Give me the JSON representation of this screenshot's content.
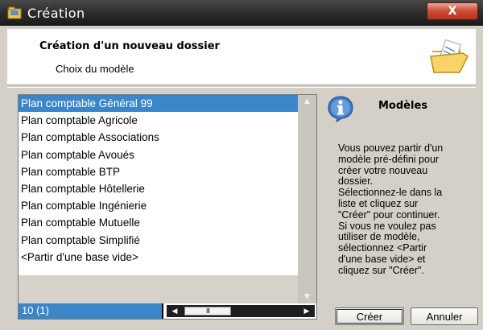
{
  "window": {
    "title": "Création",
    "close_label": "X"
  },
  "header": {
    "title": "Création d'un nouveau dossier",
    "subtitle": "Choix du modèle"
  },
  "list": {
    "items": [
      "Plan comptable  Général 99",
      "Plan comptable Agricole",
      "Plan comptable Associations",
      "Plan comptable Avoués",
      "Plan comptable BTP",
      "Plan comptable Hôtellerie",
      "Plan comptable Ingénierie",
      "Plan comptable Mutuelle",
      "Plan comptable Simplifié",
      "<Partir d'une base vide>"
    ],
    "selected_index": 0,
    "status_count": "10 (1)",
    "hscroll_thumb": "III"
  },
  "info": {
    "title": "Modèles",
    "text": "Vous pouvez partir d'un\nmodèle pré-défini pour\ncréer votre nouveau\ndossier.\nSélectionnez-le dans la\nliste et cliquez sur\n\"Créer\" pour continuer.\nSi vous ne voulez pas\nutiliser de modèle,\nsélectionnez <Partir\nd'une base vide> et\ncliquez sur \"Créer\"."
  },
  "buttons": {
    "create": "Créer",
    "cancel": "Annuler"
  },
  "colors": {
    "selection": "#3a86c8",
    "titlebar": "#2e2e2e",
    "close": "#c84a34"
  }
}
